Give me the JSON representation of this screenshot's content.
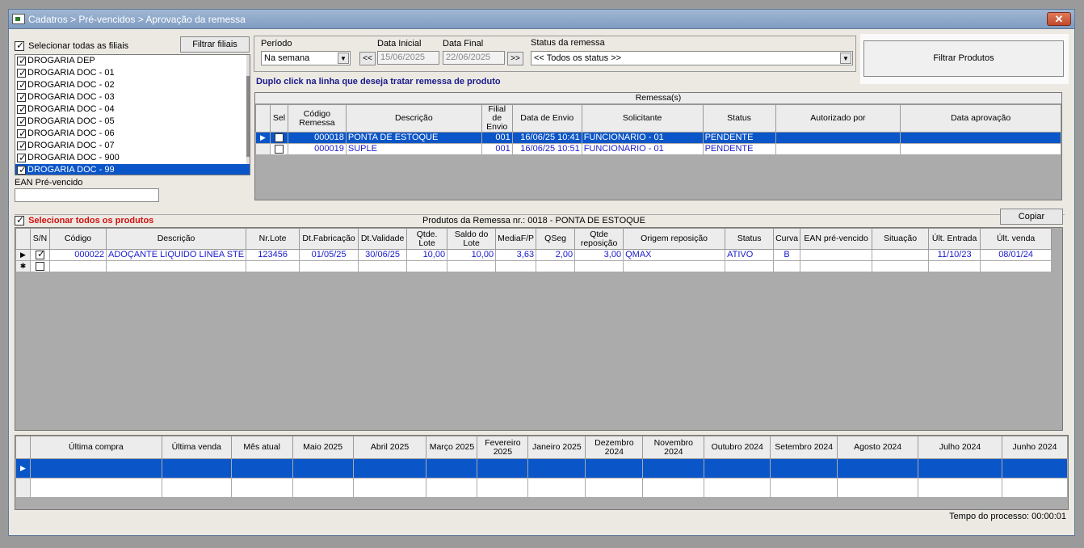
{
  "window": {
    "title": "Cadatros > Pré-vencidos > Aprovação da remessa",
    "close_label": "✕"
  },
  "filiais": {
    "select_all_label": "Selecionar todas as filiais",
    "filter_button": "Filtrar filiais",
    "items": [
      {
        "label": "DROGARIA DEP",
        "checked": true,
        "selected": false
      },
      {
        "label": "DROGARIA DOC - 01",
        "checked": true,
        "selected": false
      },
      {
        "label": "DROGARIA DOC - 02",
        "checked": true,
        "selected": false
      },
      {
        "label": "DROGARIA DOC - 03",
        "checked": true,
        "selected": false
      },
      {
        "label": "DROGARIA DOC - 04",
        "checked": true,
        "selected": false
      },
      {
        "label": "DROGARIA DOC - 05",
        "checked": true,
        "selected": false
      },
      {
        "label": "DROGARIA DOC - 06",
        "checked": true,
        "selected": false
      },
      {
        "label": "DROGARIA DOC - 07",
        "checked": true,
        "selected": false
      },
      {
        "label": "DROGARIA DOC - 900",
        "checked": true,
        "selected": false
      },
      {
        "label": "DROGARIA DOC - 99",
        "checked": true,
        "selected": true
      }
    ],
    "ean_label": "EAN Pré-vencido",
    "ean_value": ""
  },
  "filters": {
    "periodo_label": "Período",
    "periodo_value": "Na semana",
    "data_inicial_label": "Data Inicial",
    "data_inicial_value": "15/06/2025",
    "data_final_label": "Data Final",
    "data_final_value": "22/06/2025",
    "prev_label": "<<",
    "next_label": ">>",
    "status_label": "Status da remessa",
    "status_value": "<< Todos os status >>",
    "filter_products_button": "Filtrar Produtos"
  },
  "remessas": {
    "hint": "Duplo click na linha que deseja tratar remessa de produto",
    "group_header": "Remessa(s)",
    "columns": [
      "Sel",
      "Código Remessa",
      "Descrição",
      "Filial de Envio",
      "Data de Envio",
      "Solicitante",
      "Status",
      "Autorizado por",
      "Data aprovação"
    ],
    "rows": [
      {
        "codigo": "000018",
        "descricao": "PONTA DE ESTOQUE",
        "filial": "001",
        "data_envio": "16/06/25 10:41",
        "solicitante": "FUNCIONARIO - 01",
        "status": "PENDENTE",
        "autorizado": "",
        "data_aprovacao": ""
      },
      {
        "codigo": "000019",
        "descricao": "SUPLE",
        "filial": "001",
        "data_envio": "16/06/25 10:51",
        "solicitante": "FUNCIONARIO - 01",
        "status": "PENDENTE",
        "autorizado": "",
        "data_aprovacao": ""
      }
    ]
  },
  "produtos": {
    "select_all_label": "Selecionar todos os produtos",
    "caption": "Produtos da Remessa nr.: 0018 - PONTA DE ESTOQUE",
    "copy_button": "Copiar",
    "columns": [
      "S/N",
      "Código",
      "Descrição",
      "Nr.Lote",
      "Dt.Fabricação",
      "Dt.Validade",
      "Qtde. Lote",
      "Saldo do Lote",
      "MediaF/P",
      "QSeg",
      "Qtde reposição",
      "Origem reposição",
      "Status",
      "Curva",
      "EAN pré-vencido",
      "Situação",
      "Últ. Entrada",
      "Últ. venda"
    ],
    "rows": [
      {
        "codigo": "000022",
        "descricao": "ADOÇANTE LIQUIDO LINEA STE",
        "lote": "123456",
        "fabricacao": "01/05/25",
        "validade": "30/06/25",
        "qtde_lote": "10,00",
        "saldo": "10,00",
        "media": "3,63",
        "qseg": "2,00",
        "qtde_rep": "3,00",
        "origem": "QMAX",
        "status": "ATIVO",
        "curva": "B",
        "ean": "",
        "situacao": "",
        "ult_entrada": "11/10/23",
        "ult_venda": "08/01/24"
      }
    ]
  },
  "historico": {
    "columns": [
      "Última compra",
      "Última venda",
      "Mês atual",
      "Maio 2025",
      "Abril 2025",
      "Março 2025",
      "Fevereiro 2025",
      "Janeiro 2025",
      "Dezembro 2024",
      "Novembro 2024",
      "Outubro 2024",
      "Setembro 2024",
      "Agosto 2024",
      "Julho 2024",
      "Junho 2024"
    ]
  },
  "statusbar": {
    "tempo": "Tempo do processo: 00:00:01"
  }
}
